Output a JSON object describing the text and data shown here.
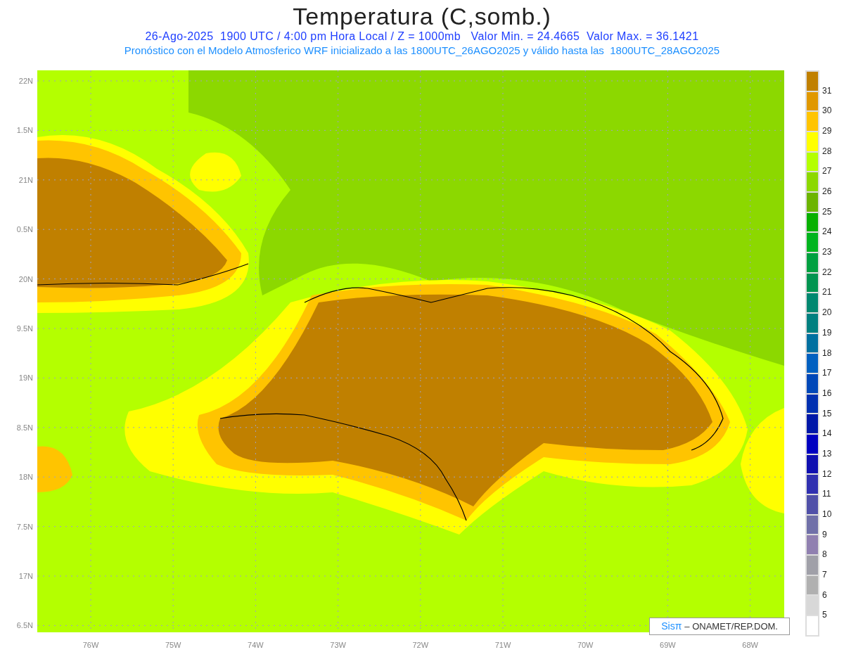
{
  "title": "Temperatura (C,somb.)",
  "subtitle": "26-Ago-2025  1900 UTC / 4:00 pm Hora Local / Z = 1000mb   Valor Min. = 24.4665  Valor Max. = 36.1421",
  "forecast_note": "Pronóstico con el Modelo Atmosferico WRF inicializado a las 1800UTC_26AGO2025 y válido hasta las  1800UTC_28AGO2025",
  "map": {
    "y_ticks": [
      "22N",
      "1.5N",
      "21N",
      "0.5N",
      "20N",
      "9.5N",
      "19N",
      "8.5N",
      "18N",
      "7.5N",
      "17N",
      "6.5N"
    ],
    "x_ticks": [
      "76W",
      "75W",
      "74W",
      "73W",
      "72W",
      "71W",
      "70W",
      "69W",
      "68W"
    ]
  },
  "legend": [
    {
      "color": "#c08000",
      "label": "31"
    },
    {
      "color": "#e09800",
      "label": "30"
    },
    {
      "color": "#ffc400",
      "label": "29"
    },
    {
      "color": "#ffff00",
      "label": "28"
    },
    {
      "color": "#b4ff00",
      "label": "27"
    },
    {
      "color": "#8cd800",
      "label": "26"
    },
    {
      "color": "#6cb400",
      "label": "25"
    },
    {
      "color": "#08b000",
      "label": "24"
    },
    {
      "color": "#00b41e",
      "label": "23"
    },
    {
      "color": "#00a040",
      "label": "22"
    },
    {
      "color": "#009450",
      "label": "21"
    },
    {
      "color": "#008870",
      "label": "20"
    },
    {
      "color": "#008080",
      "label": "19"
    },
    {
      "color": "#0070a0",
      "label": "18"
    },
    {
      "color": "#0060c0",
      "label": "17"
    },
    {
      "color": "#0048b8",
      "label": "16"
    },
    {
      "color": "#0030b0",
      "label": "15"
    },
    {
      "color": "#0018a8",
      "label": "14"
    },
    {
      "color": "#0000c0",
      "label": "13"
    },
    {
      "color": "#1010b0",
      "label": "12"
    },
    {
      "color": "#3030b0",
      "label": "11"
    },
    {
      "color": "#5050a8",
      "label": "10"
    },
    {
      "color": "#7070a8",
      "label": "9"
    },
    {
      "color": "#9080b0",
      "label": "8"
    },
    {
      "color": "#a0a0a8",
      "label": "7"
    },
    {
      "color": "#b0b0b0",
      "label": "6"
    },
    {
      "color": "#d8d8d8",
      "label": "5"
    },
    {
      "color": "#ffffff"
    }
  ],
  "credit": {
    "brand": "Sisπ",
    "text": "– ONAMET/REP.DOM."
  }
}
